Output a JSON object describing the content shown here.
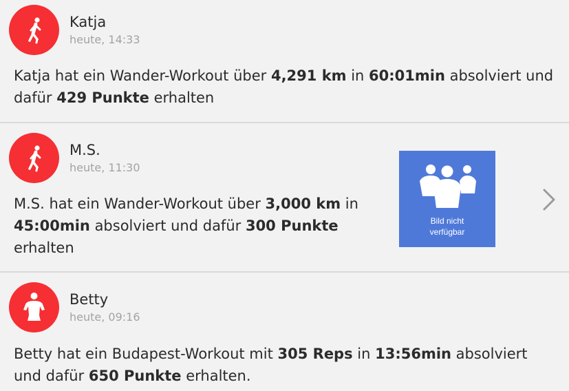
{
  "feed": [
    {
      "user": "Katja",
      "time": "heute, 14:33",
      "avatar_icon": "hiker-icon",
      "text": {
        "p1": "Katja hat ein Wander-Workout über ",
        "b1": "4,291 km",
        "p2": " in ",
        "b2": "60:01min",
        "p3": " absolviert und dafür ",
        "b3": "429 Punkte",
        "p4": " erhalten"
      }
    },
    {
      "user": "M.S.",
      "time": "heute, 11:30",
      "avatar_icon": "hiker-icon",
      "text": {
        "p1": "M.S. hat ein Wander-Workout über ",
        "b1": "3,000 km",
        "p2": " in ",
        "b2": "45:00min",
        "p3": " absolviert und dafür ",
        "b3": "300 Punkte",
        "p4": " erhalten"
      },
      "image": {
        "caption_line1": "Bild nicht",
        "caption_line2": "verfügbar",
        "icon": "people-placeholder-icon"
      },
      "chevron": "chevron-right-icon"
    },
    {
      "user": "Betty",
      "time": "heute, 09:16",
      "avatar_icon": "bodyweight-icon",
      "text": {
        "p1": "Betty hat ein Budapest-Workout mit ",
        "b1": "305 Reps",
        "p2": " in ",
        "b2": "13:56min",
        "p3": " absolviert und dafür ",
        "b3": "650 Punkte",
        "p4": " erhalten."
      }
    }
  ],
  "colors": {
    "avatar": "#f52f33",
    "background": "#f2f2f2",
    "thumb": "#4f79d9",
    "secondary_text": "#a3a3a3"
  }
}
